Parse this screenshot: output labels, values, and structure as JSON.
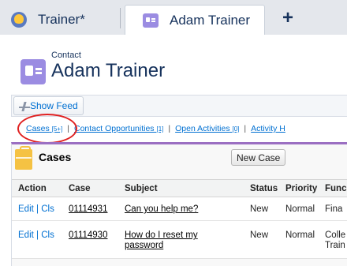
{
  "tabs": [
    {
      "label": "Trainer*",
      "icon": "trainer-icon"
    },
    {
      "label": "Adam Trainer",
      "icon": "contact-icon",
      "active": true
    }
  ],
  "add_tab_label": "+",
  "header": {
    "object_label": "Contact",
    "record_name": "Adam Trainer"
  },
  "feed": {
    "show_feed_label": "Show Feed"
  },
  "related_links": {
    "cases": {
      "label": "Cases",
      "count": "[5+]"
    },
    "opportunities": {
      "label": "Contact Opportunities",
      "count": "[1]"
    },
    "activities": {
      "label": "Open Activities",
      "count": "[0]"
    },
    "history": {
      "label": "Activity H"
    },
    "separator": "|"
  },
  "cases": {
    "title": "Cases",
    "new_button": "New Case",
    "columns": [
      "Action",
      "Case",
      "Subject",
      "Status",
      "Priority",
      "Func"
    ],
    "rows": [
      {
        "edit": "Edit",
        "sep": "|",
        "close": "Cls",
        "case": "01114931",
        "subject_1": "Can you help me?",
        "subject_2": "",
        "status": "New",
        "priority": "Normal",
        "func_1": "Fina",
        "func_2": ""
      },
      {
        "edit": "Edit",
        "sep": "|",
        "close": "Cls",
        "case": "01114930",
        "subject_1": "How do I reset my",
        "subject_2": "password",
        "status": "New",
        "priority": "Normal",
        "func_1": "Colle",
        "func_2": "Train"
      }
    ]
  },
  "colors": {
    "accent_purple": "#9b6fc2",
    "contact_icon": "#9b8ce2",
    "link_blue": "#0070d2",
    "highlight_red": "#e02020",
    "cases_icon": "#f5c243"
  }
}
